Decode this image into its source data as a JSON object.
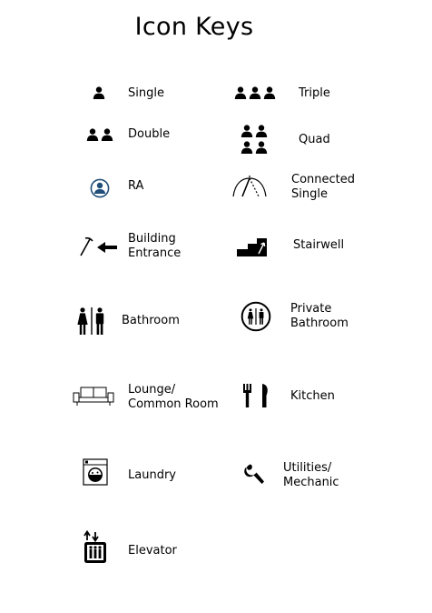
{
  "title": "Icon Keys",
  "colors": {
    "ra_blue": "#1f4e79",
    "ink": "#000000"
  },
  "keys": [
    {
      "icon": "single-icon",
      "label": "Single"
    },
    {
      "icon": "triple-icon",
      "label": "Triple"
    },
    {
      "icon": "double-icon",
      "label": "Double"
    },
    {
      "icon": "quad-icon",
      "label": "Quad"
    },
    {
      "icon": "ra-icon",
      "label": "RA"
    },
    {
      "icon": "connected-single-icon",
      "label": "Connected\nSingle"
    },
    {
      "icon": "building-entrance-icon",
      "label": "Building\nEntrance"
    },
    {
      "icon": "stairwell-icon",
      "label": "Stairwell"
    },
    {
      "icon": "bathroom-icon",
      "label": "Bathroom"
    },
    {
      "icon": "private-bathroom-icon",
      "label": "Private\nBathroom"
    },
    {
      "icon": "lounge-icon",
      "label": "Lounge/\nCommon Room"
    },
    {
      "icon": "kitchen-icon",
      "label": "Kitchen"
    },
    {
      "icon": "laundry-icon",
      "label": "Laundry"
    },
    {
      "icon": "utilities-icon",
      "label": "Utilities/\nMechanic"
    },
    {
      "icon": "elevator-icon",
      "label": "Elevator"
    }
  ]
}
